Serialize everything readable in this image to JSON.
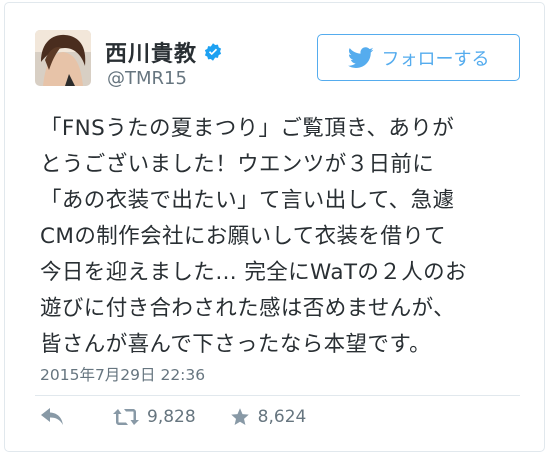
{
  "author": {
    "display_name": "西川貴教",
    "handle": "@TMR15",
    "verified": true,
    "avatar_icon": "profile-photo"
  },
  "follow_button": {
    "label": "フォローする",
    "icon": "twitter-bird-icon"
  },
  "tweet": {
    "lines": [
      "「FNSうたの夏まつり」ご覧頂き、ありが",
      "とうございました！ウエンツが３日前に",
      "「あの衣装で出たい」て言い出して、急遽",
      "CMの制作会社にお願いして衣装を借りて",
      "今日を迎えました… 完全にWaTの２人のお",
      "遊びに付き合わされた感は否めませんが、",
      "皆さんが喜んで下さったなら本望です。"
    ],
    "timestamp": "2015年7月29日 22:36"
  },
  "actions": {
    "reply_icon": "reply-icon",
    "retweet_count": "9,828",
    "like_count": "8,624"
  },
  "colors": {
    "accent": "#55acee",
    "text": "#292f33",
    "muted": "#66757f",
    "verified": "#1da1f2"
  }
}
